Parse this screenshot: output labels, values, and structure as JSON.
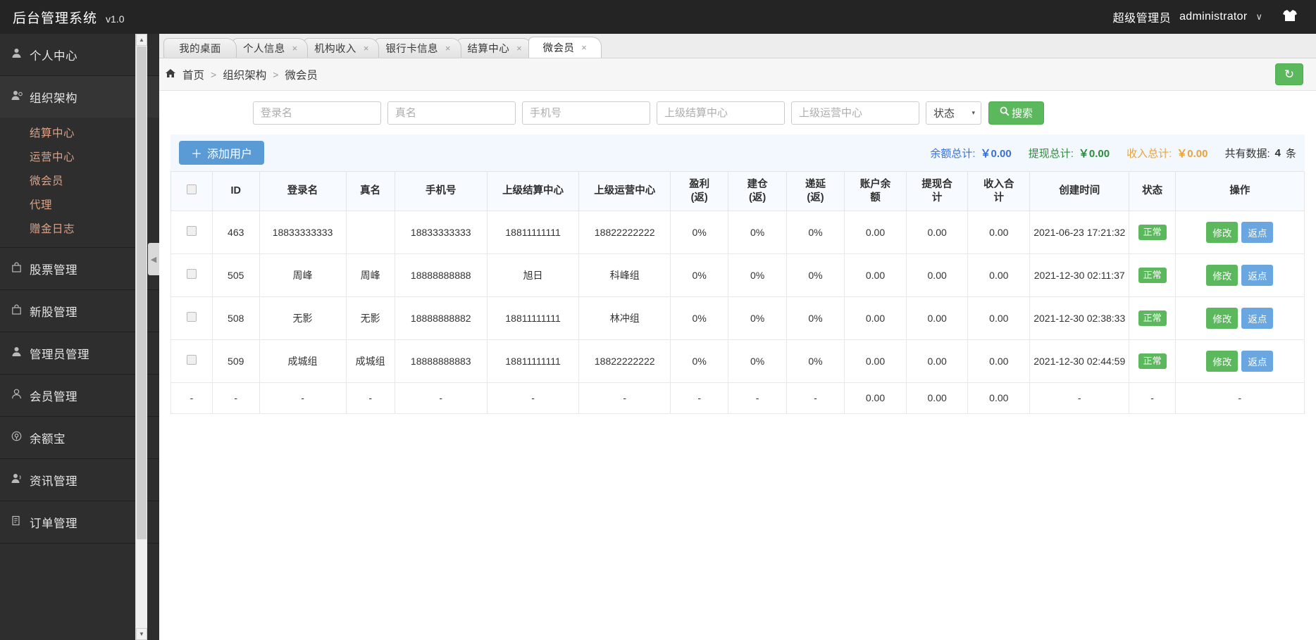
{
  "header": {
    "brand_title": "后台管理系统",
    "version": "v1.0",
    "role": "超级管理员",
    "username": "administrator",
    "caret": "∨",
    "shirt_icon": "shirt-icon"
  },
  "sidebar": {
    "groups": [
      {
        "icon": "user-icon",
        "label": "个人中心",
        "chev": "∨",
        "open": false,
        "children": []
      },
      {
        "icon": "org-icon",
        "label": "组织架构",
        "chev": "∧",
        "open": true,
        "children": [
          "结算中心",
          "运营中心",
          "微会员",
          "代理",
          "赠金日志"
        ]
      },
      {
        "icon": "bag-icon",
        "label": "股票管理",
        "chev": "∨",
        "open": false,
        "children": []
      },
      {
        "icon": "bag-icon",
        "label": "新股管理",
        "chev": "∨",
        "open": false,
        "children": []
      },
      {
        "icon": "user-icon",
        "label": "管理员管理",
        "chev": "∨",
        "open": false,
        "children": []
      },
      {
        "icon": "member-icon",
        "label": "会员管理",
        "chev": "∨",
        "open": false,
        "children": []
      },
      {
        "icon": "coin-icon",
        "label": "余额宝",
        "chev": "∨",
        "open": false,
        "children": []
      },
      {
        "icon": "news-icon",
        "label": "资讯管理",
        "chev": "∨",
        "open": false,
        "children": []
      },
      {
        "icon": "doc-icon",
        "label": "订单管理",
        "chev": "∨",
        "open": false,
        "children": []
      }
    ],
    "scroll_up_icon": "chevron-up-icon",
    "scroll_down_icon": "chevron-down-icon"
  },
  "tabs": [
    {
      "label": "我的桌面",
      "closable": false,
      "active": false,
      "close": ""
    },
    {
      "label": "个人信息",
      "closable": true,
      "active": false,
      "close": "×"
    },
    {
      "label": "机构收入",
      "closable": true,
      "active": false,
      "close": "×"
    },
    {
      "label": "银行卡信息",
      "closable": true,
      "active": false,
      "close": "×"
    },
    {
      "label": "结算中心",
      "closable": true,
      "active": false,
      "close": "×"
    },
    {
      "label": "微会员",
      "closable": true,
      "active": true,
      "close": "×"
    }
  ],
  "breadcrumb": {
    "home_icon": "home-icon",
    "items": [
      "首页",
      "组织架构",
      "微会员"
    ],
    "separator": ">",
    "refresh_icon": "↻"
  },
  "filters": {
    "login_name_placeholder": "登录名",
    "login_name_value": "",
    "real_name_placeholder": "真名",
    "real_name_value": "",
    "phone_placeholder": "手机号",
    "phone_value": "",
    "parent_settlement_placeholder": "上级结算中心",
    "parent_settlement_value": "",
    "parent_operation_placeholder": "上级运营中心",
    "parent_operation_value": "",
    "status_label": "状态",
    "status_caret": "▾",
    "search_label": "搜索",
    "search_icon": "search-icon"
  },
  "toolbar": {
    "add_user_label": "添加用户",
    "add_icon": "＋",
    "stats": [
      {
        "label": "余额总计:",
        "value": "￥0.00",
        "color": "#3a6fd8"
      },
      {
        "label": "提现总计:",
        "value": "￥0.00",
        "color": "#2e8b3d"
      },
      {
        "label": "收入总计:",
        "value": "￥0.00",
        "color": "#e8a33d"
      }
    ],
    "total_label": "共有数据:",
    "total_count": "4",
    "total_unit": "条"
  },
  "table": {
    "columns": [
      "",
      "ID",
      "登录名",
      "真名",
      "手机号",
      "上级结算中心",
      "上级运营中心",
      "盈利\n(返)",
      "建仓\n(返)",
      "递延\n(返)",
      "账户余\n额",
      "提现合\n计",
      "收入合\n计",
      "创建时间",
      "状态",
      "操作"
    ],
    "rows": [
      {
        "id": "463",
        "login": "18833333333",
        "real": "",
        "phone": "18833333333",
        "parent_settlement": "18811111111",
        "parent_operation": "18822222222",
        "profit": "0%",
        "open": "0%",
        "defer": "0%",
        "balance": "0.00",
        "withdraw": "0.00",
        "income": "0.00",
        "created": "2021-06-23 17:21:32",
        "status": "正常",
        "edit": "修改",
        "rebate": "返点"
      },
      {
        "id": "505",
        "login": "周峰",
        "real": "周峰",
        "phone": "18888888888",
        "parent_settlement": "旭日",
        "parent_operation": "科峰组",
        "profit": "0%",
        "open": "0%",
        "defer": "0%",
        "balance": "0.00",
        "withdraw": "0.00",
        "income": "0.00",
        "created": "2021-12-30 02:11:37",
        "status": "正常",
        "edit": "修改",
        "rebate": "返点"
      },
      {
        "id": "508",
        "login": "无影",
        "real": "无影",
        "phone": "18888888882",
        "parent_settlement": "18811111111",
        "parent_operation": "林冲组",
        "profit": "0%",
        "open": "0%",
        "defer": "0%",
        "balance": "0.00",
        "withdraw": "0.00",
        "income": "0.00",
        "created": "2021-12-30 02:38:33",
        "status": "正常",
        "edit": "修改",
        "rebate": "返点"
      },
      {
        "id": "509",
        "login": "成城组",
        "real": "成城组",
        "phone": "18888888883",
        "parent_settlement": "18811111111",
        "parent_operation": "18822222222",
        "profit": "0%",
        "open": "0%",
        "defer": "0%",
        "balance": "0.00",
        "withdraw": "0.00",
        "income": "0.00",
        "created": "2021-12-30 02:44:59",
        "status": "正常",
        "edit": "修改",
        "rebate": "返点"
      }
    ],
    "summary_row": {
      "id": "-",
      "login": "-",
      "real": "-",
      "phone": "-",
      "parent_settlement": "-",
      "parent_operation": "-",
      "profit": "-",
      "open": "-",
      "defer": "-",
      "balance": "0.00",
      "withdraw": "0.00",
      "income": "0.00",
      "created": "-",
      "status": "-",
      "action": "-",
      "cb": "-"
    }
  },
  "drag_handle": {
    "icon": "◀"
  }
}
